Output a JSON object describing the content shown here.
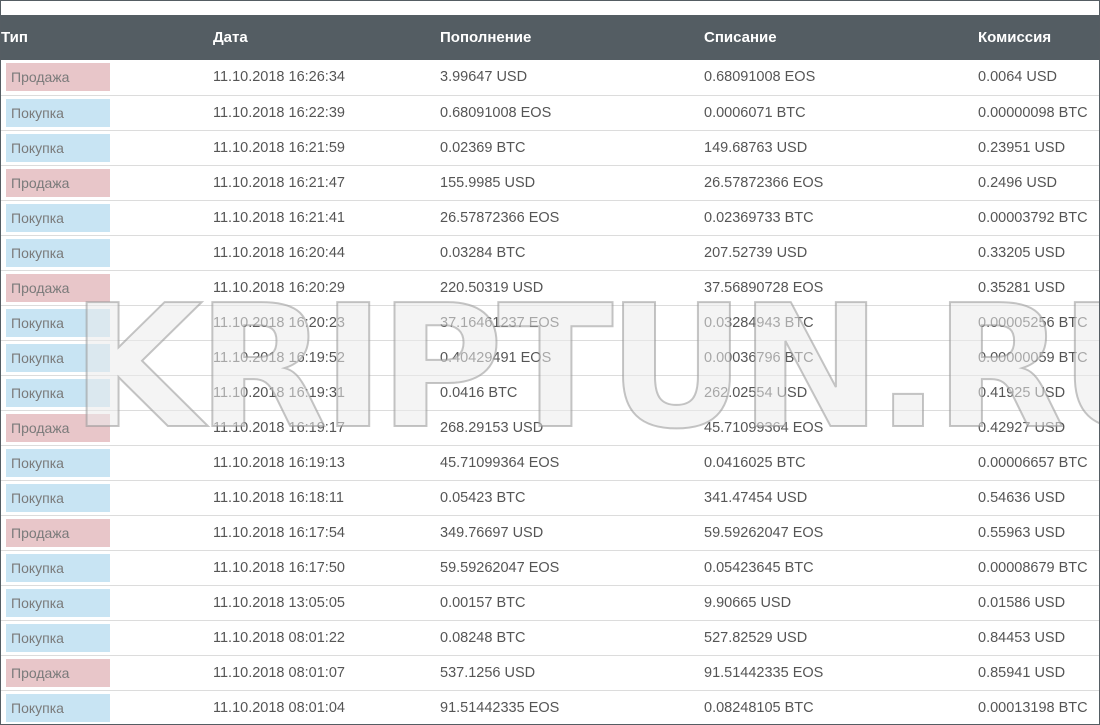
{
  "table": {
    "headers": {
      "type": "Тип",
      "date": "Дата",
      "deposit": "Пополнение",
      "withdrawal": "Списание",
      "fee": "Комиссия"
    },
    "rows": [
      {
        "type": "Продажа",
        "kind": "sell",
        "date": "11.10.2018 16:26:34",
        "deposit": "3.99647 USD",
        "withdrawal": "0.68091008 EOS",
        "fee": "0.0064 USD"
      },
      {
        "type": "Покупка",
        "kind": "buy",
        "date": "11.10.2018 16:22:39",
        "deposit": "0.68091008 EOS",
        "withdrawal": "0.0006071 BTC",
        "fee": "0.00000098 BTC"
      },
      {
        "type": "Покупка",
        "kind": "buy",
        "date": "11.10.2018 16:21:59",
        "deposit": "0.02369 BTC",
        "withdrawal": "149.68763 USD",
        "fee": "0.23951 USD"
      },
      {
        "type": "Продажа",
        "kind": "sell",
        "date": "11.10.2018 16:21:47",
        "deposit": "155.9985 USD",
        "withdrawal": "26.57872366 EOS",
        "fee": "0.2496 USD"
      },
      {
        "type": "Покупка",
        "kind": "buy",
        "date": "11.10.2018 16:21:41",
        "deposit": "26.57872366 EOS",
        "withdrawal": "0.02369733 BTC",
        "fee": "0.00003792 BTC"
      },
      {
        "type": "Покупка",
        "kind": "buy",
        "date": "11.10.2018 16:20:44",
        "deposit": "0.03284 BTC",
        "withdrawal": "207.52739 USD",
        "fee": "0.33205 USD"
      },
      {
        "type": "Продажа",
        "kind": "sell",
        "date": "11.10.2018 16:20:29",
        "deposit": "220.50319 USD",
        "withdrawal": "37.56890728 EOS",
        "fee": "0.35281 USD"
      },
      {
        "type": "Покупка",
        "kind": "buy",
        "date": "11.10.2018 16:20:23",
        "deposit": "37.16461237 EOS",
        "withdrawal": "0.03284943 BTC",
        "fee": "0.00005256 BTC"
      },
      {
        "type": "Покупка",
        "kind": "buy",
        "date": "11.10.2018 16:19:52",
        "deposit": "0.40429491 EOS",
        "withdrawal": "0.00036796 BTC",
        "fee": "0.00000059 BTC"
      },
      {
        "type": "Покупка",
        "kind": "buy",
        "date": "11.10.2018 16:19:31",
        "deposit": "0.0416 BTC",
        "withdrawal": "262.02554 USD",
        "fee": "0.41925 USD"
      },
      {
        "type": "Продажа",
        "kind": "sell",
        "date": "11.10.2018 16:19:17",
        "deposit": "268.29153 USD",
        "withdrawal": "45.71099364 EOS",
        "fee": "0.42927 USD"
      },
      {
        "type": "Покупка",
        "kind": "buy",
        "date": "11.10.2018 16:19:13",
        "deposit": "45.71099364 EOS",
        "withdrawal": "0.0416025 BTC",
        "fee": "0.00006657 BTC"
      },
      {
        "type": "Покупка",
        "kind": "buy",
        "date": "11.10.2018 16:18:11",
        "deposit": "0.05423 BTC",
        "withdrawal": "341.47454 USD",
        "fee": "0.54636 USD"
      },
      {
        "type": "Продажа",
        "kind": "sell",
        "date": "11.10.2018 16:17:54",
        "deposit": "349.76697 USD",
        "withdrawal": "59.59262047 EOS",
        "fee": "0.55963 USD"
      },
      {
        "type": "Покупка",
        "kind": "buy",
        "date": "11.10.2018 16:17:50",
        "deposit": "59.59262047 EOS",
        "withdrawal": "0.05423645 BTC",
        "fee": "0.00008679 BTC"
      },
      {
        "type": "Покупка",
        "kind": "buy",
        "date": "11.10.2018 13:05:05",
        "deposit": "0.00157 BTC",
        "withdrawal": "9.90665 USD",
        "fee": "0.01586 USD"
      },
      {
        "type": "Покупка",
        "kind": "buy",
        "date": "11.10.2018 08:01:22",
        "deposit": "0.08248 BTC",
        "withdrawal": "527.82529 USD",
        "fee": "0.84453 USD"
      },
      {
        "type": "Продажа",
        "kind": "sell",
        "date": "11.10.2018 08:01:07",
        "deposit": "537.1256 USD",
        "withdrawal": "91.51442335 EOS",
        "fee": "0.85941 USD"
      },
      {
        "type": "Покупка",
        "kind": "buy",
        "date": "11.10.2018 08:01:04",
        "deposit": "91.51442335 EOS",
        "withdrawal": "0.08248105 BTC",
        "fee": "0.00013198 BTC"
      }
    ]
  },
  "watermark": {
    "text": "KRIPTUN.RU"
  },
  "colors": {
    "header_bg": "#545d63",
    "sell_badge": "#e8c6c9",
    "buy_badge": "#c8e4f3"
  }
}
